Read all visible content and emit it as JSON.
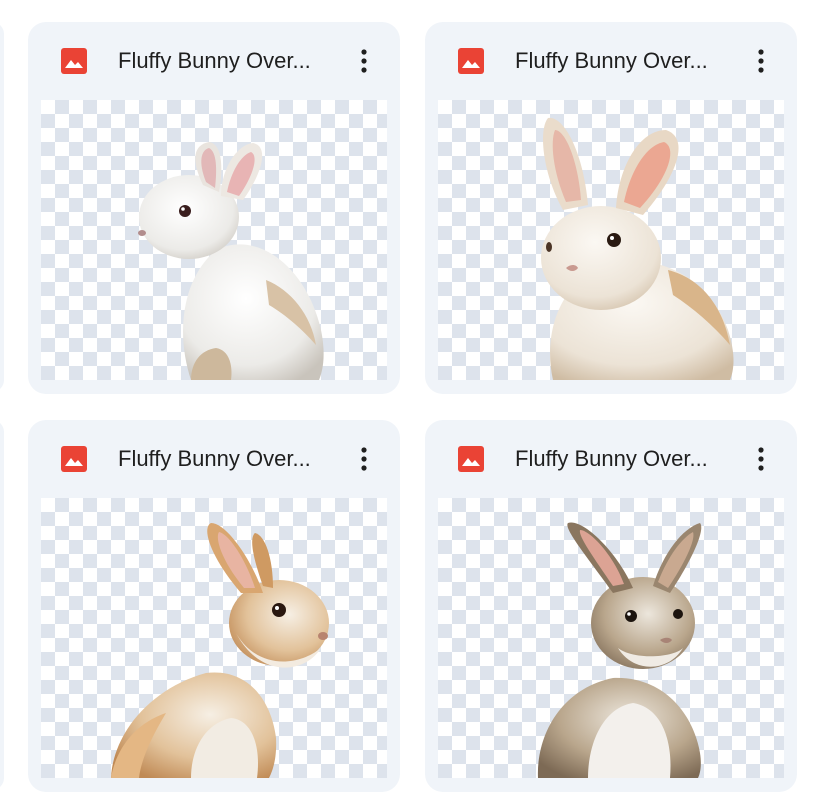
{
  "files": [
    {
      "title": "Fluffy Bunny Over...",
      "file_type_icon": "image-icon",
      "menu_icon": "more-vert-icon",
      "thumbnail": "white bunny with pink ears, side profile, facing left"
    },
    {
      "title": "Fluffy Bunny Over...",
      "file_type_icon": "image-icon",
      "menu_icon": "more-vert-icon",
      "thumbnail": "cream bunny with tall ears, facing forward"
    },
    {
      "title": "Fluffy Bunny Over...",
      "file_type_icon": "image-icon",
      "menu_icon": "more-vert-icon",
      "thumbnail": "tan and white bunny, facing right"
    },
    {
      "title": "Fluffy Bunny Over...",
      "file_type_icon": "image-icon",
      "menu_icon": "more-vert-icon",
      "thumbnail": "gray-brown bunny with white chest, facing forward"
    }
  ],
  "colors": {
    "card_bg": "#f0f4f9",
    "image_icon_red": "#ea4335",
    "title_text": "#1f1f1f",
    "checker_light": "#ffffff",
    "checker_dark": "#dde3ec"
  }
}
